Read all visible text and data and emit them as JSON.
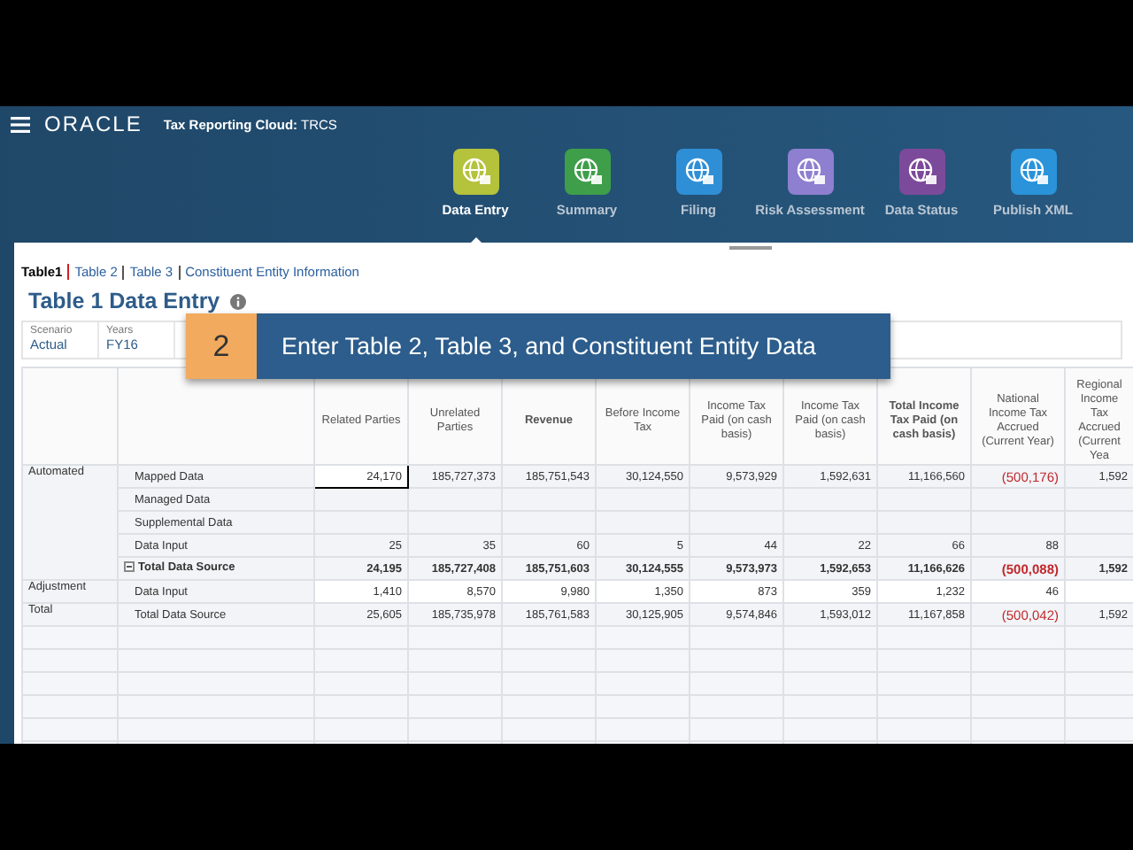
{
  "header": {
    "logo": "ORACLE",
    "title": "**Tax Reporting Cloud:** TRCS"
  },
  "nav": [
    {
      "label": "Data Entry",
      "color": "#b5c23c",
      "selected": true
    },
    {
      "label": "Summary",
      "color": "#3f9e4a",
      "selected": false
    },
    {
      "label": "Filing",
      "color": "#2f8fd6",
      "selected": false
    },
    {
      "label": "Risk Assessment",
      "color": "#8e7fd0",
      "selected": false
    },
    {
      "label": "Data Status",
      "color": "#7c4a9a",
      "selected": false
    },
    {
      "label": "Publish XML",
      "color": "#2a93d9",
      "selected": false
    }
  ],
  "tabs": [
    {
      "label": "Table1",
      "selected": true
    },
    {
      "label": "Table 2",
      "selected": false
    },
    {
      "label": "Table 3",
      "selected": false
    },
    {
      "label": "Constituent Entity Information",
      "selected": false
    }
  ],
  "page_title": "Table 1 Data Entry",
  "pov": [
    {
      "label": "Scenario",
      "value": "Actual"
    },
    {
      "label": "Years",
      "value": "FY16"
    }
  ],
  "callout": {
    "number": "2",
    "text": "Enter Table 2, Table 3, and Constituent Entity Data"
  },
  "table": {
    "columns": [
      {
        "label": "Related Parties",
        "bold": false
      },
      {
        "label": "Unrelated Parties",
        "bold": false
      },
      {
        "label": "Revenue",
        "bold": true
      },
      {
        "label": "Before Income Tax",
        "bold": false
      },
      {
        "label": "Income Tax Paid (on cash basis)",
        "bold": false
      },
      {
        "label": "Income Tax Paid (on cash basis)",
        "bold": false
      },
      {
        "label": "Total Income Tax Paid (on cash basis)",
        "bold": true
      },
      {
        "label": "National Income Tax Accrued (Current Year)",
        "bold": false
      },
      {
        "label": "Regional Income Tax Accrued (Current Yea",
        "bold": false
      }
    ],
    "rows": [
      {
        "group": "Automated",
        "label": "Mapped Data",
        "kind": "data",
        "cells": [
          {
            "v": "24,170",
            "selected": true
          },
          "185,727,373",
          "185,751,543",
          "30,124,550",
          "9,573,929",
          "1,592,631",
          "11,166,560",
          {
            "v": "(500,176)",
            "negative": true
          },
          "1,592"
        ]
      },
      {
        "label": "Managed Data",
        "kind": "data",
        "cells": []
      },
      {
        "label": "Supplemental Data",
        "kind": "data",
        "cells": []
      },
      {
        "label": "Data Input",
        "kind": "data",
        "cells": [
          "25",
          "35",
          "60",
          "5",
          "44",
          "22",
          "66",
          "88"
        ]
      },
      {
        "label": "Total Data Source",
        "kind": "subtotal",
        "expanded": true,
        "cells": [
          "24,195",
          "185,727,408",
          "185,751,603",
          "30,124,555",
          "9,573,973",
          "1,592,653",
          "11,166,626",
          {
            "v": "(500,088)",
            "negative": true
          },
          "1,592"
        ]
      },
      {
        "group": "Adjustment",
        "label": "Data Input",
        "kind": "input",
        "cells": [
          "1,410",
          "8,570",
          "9,980",
          "1,350",
          "873",
          "359",
          "1,232",
          "46"
        ]
      },
      {
        "group": "Total",
        "label": "Total Data Source",
        "kind": "total",
        "cells": [
          "25,605",
          "185,735,978",
          "185,761,583",
          "30,125,905",
          "9,574,846",
          "1,593,012",
          "11,167,858",
          {
            "v": "(500,042)",
            "negative": true
          },
          "1,592"
        ]
      }
    ]
  }
}
